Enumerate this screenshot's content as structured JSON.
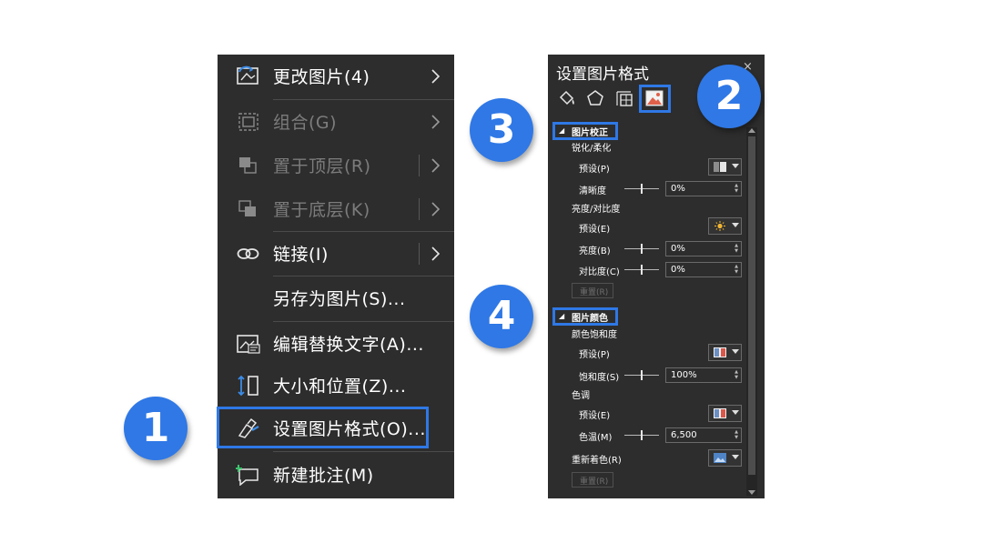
{
  "context_menu": {
    "items": [
      {
        "label": "更改图片(4)",
        "icon": "change-picture-icon",
        "disabled": false,
        "submenu": true
      },
      {
        "label": "组合(G)",
        "icon": "group-icon",
        "disabled": true,
        "submenu": true
      },
      {
        "label": "置于顶层(R)",
        "icon": "bring-to-front-icon",
        "disabled": true,
        "submenu": true
      },
      {
        "label": "置于底层(K)",
        "icon": "send-to-back-icon",
        "disabled": true,
        "submenu": true
      },
      {
        "label": "链接(I)",
        "icon": "link-icon",
        "disabled": false,
        "submenu": true
      },
      {
        "label": "另存为图片(S)...",
        "icon": "",
        "disabled": false,
        "submenu": false
      },
      {
        "label": "编辑替换文字(A)...",
        "icon": "alt-text-icon",
        "disabled": false,
        "submenu": false
      },
      {
        "label": "大小和位置(Z)...",
        "icon": "size-position-icon",
        "disabled": false,
        "submenu": false
      },
      {
        "label": "设置图片格式(O)...",
        "icon": "format-picture-icon",
        "disabled": false,
        "submenu": false,
        "highlighted": true
      },
      {
        "label": "新建批注(M)",
        "icon": "new-comment-icon",
        "disabled": false,
        "submenu": false
      }
    ]
  },
  "format_pane": {
    "title": "设置图片格式",
    "close": "×",
    "tabs": [
      "fill-line-icon",
      "effects-icon",
      "size-properties-icon",
      "picture-icon"
    ],
    "active_tab": "picture-icon",
    "correction": {
      "header": "图片校正",
      "sharpen_label": "锐化/柔化",
      "preset_label": "预设(P)",
      "clarity_label": "清晰度",
      "clarity_value": "0%",
      "brightness_contrast_label": "亮度/对比度",
      "bc_preset_label": "预设(E)",
      "brightness_label": "亮度(B)",
      "brightness_value": "0%",
      "contrast_label": "对比度(C)",
      "contrast_value": "0%",
      "reset_label": "重置(R)"
    },
    "color": {
      "header": "图片颜色",
      "saturation_group_label": "颜色饱和度",
      "sat_preset_label": "预设(P)",
      "saturation_label": "饱和度(S)",
      "saturation_value": "100%",
      "tone_label": "色调",
      "tone_preset_label": "预设(E)",
      "temperature_label": "色温(M)",
      "temperature_value": "6,500",
      "recolor_label": "重新着色(R)",
      "reset_label": "重置(R)"
    }
  },
  "badges": [
    "1",
    "2",
    "3",
    "4"
  ],
  "colors": {
    "accent": "#2f78e6",
    "panel_bg": "#2d2d2d",
    "disabled_text": "#7c7c7c"
  }
}
